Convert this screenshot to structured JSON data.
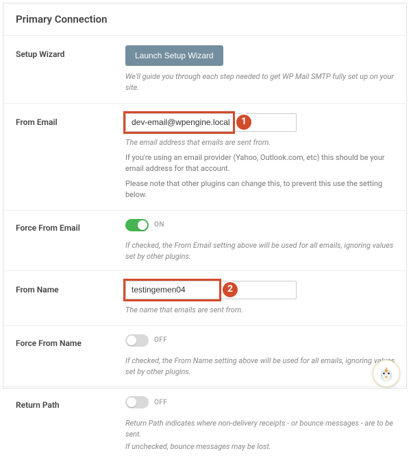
{
  "section_title": "Primary Connection",
  "setup_wizard": {
    "label": "Setup Wizard",
    "button": "Launch Setup Wizard",
    "help": "We'll guide you through each step needed to get WP Mail SMTP fully set up on your site."
  },
  "from_email": {
    "label": "From Email",
    "value": "dev-email@wpengine.local",
    "help1": "The email address that emails are sent from.",
    "help2": "If you're using an email provider (Yahoo, Outlook.com, etc) this should be your email address for that account.",
    "help3": "Please note that other plugins can change this, to prevent this use the setting below."
  },
  "force_from_email": {
    "label": "Force From Email",
    "state": "ON",
    "help": "If checked, the From Email setting above will be used for all emails, ignoring values set by other plugins."
  },
  "from_name": {
    "label": "From Name",
    "value": "testingemen04",
    "help": "The name that emails are sent from."
  },
  "force_from_name": {
    "label": "Force From Name",
    "state": "OFF",
    "help": "If checked, the From Name setting above will be used for all emails, ignoring values set by other plugins."
  },
  "return_path": {
    "label": "Return Path",
    "state": "OFF",
    "help1": "Return Path indicates where non-delivery receipts - or bounce messages - are to be sent.",
    "help2": "If unchecked, bounce messages may be lost."
  },
  "callouts": {
    "one": "1",
    "two": "2"
  },
  "colors": {
    "accent": "#d34b2b",
    "toggle_on": "#46b450"
  }
}
